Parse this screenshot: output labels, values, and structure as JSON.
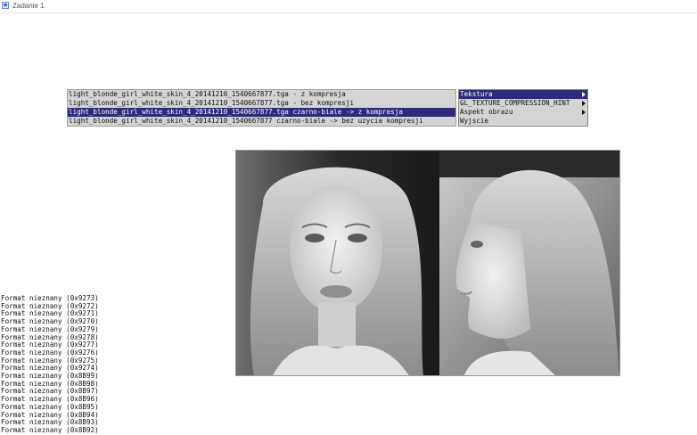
{
  "window": {
    "title": "Zadanie 1"
  },
  "submenu": {
    "items": [
      "light_blonde_girl_white_skin_4_20141210_1540667877.tga - z kompresja",
      "light_blonde_girl_white_skin_4_20141210_1540667877.tga  - bez kompresji",
      "light_blonde_girl_white_skin_4_20141210_1540667877.tga czarno-biale -> z kompresja",
      "light_blonde_girl_white_skin_4_20141210_1540667877 czarno-biale -> bez uzycia kompresji"
    ],
    "selected_index": 2
  },
  "menu": {
    "items": [
      {
        "label": "Tekstura",
        "has_submenu": true
      },
      {
        "label": "GL_TEXTURE_COMPRESSION_HINT",
        "has_submenu": true
      },
      {
        "label": "Aspekt obrazu",
        "has_submenu": true
      },
      {
        "label": "Wyjscie",
        "has_submenu": false
      }
    ],
    "selected_index": 0
  },
  "console": {
    "lines": [
      "Format nieznany (0x9273)",
      "Format nieznany (0x9272)",
      "Format nieznany (0x9271)",
      "Format nieznany (0x9270)",
      "Format nieznany (0x9279)",
      "Format nieznany (0x9278)",
      "Format nieznany (0x9277)",
      "Format nieznany (0x9276)",
      "Format nieznany (0x9275)",
      "Format nieznany (0x9274)",
      "Format nieznany (0x8B99)",
      "Format nieznany (0x8B98)",
      "Format nieznany (0x8B97)",
      "Format nieznany (0x8B96)",
      "Format nieznany (0x8B95)",
      "Format nieznany (0x8B94)",
      "Format nieznany (0x8B93)",
      "Format nieznany (0x8B92)"
    ]
  },
  "colors": {
    "menu_background": "#d4d4d4",
    "selection": "#2c2a79",
    "selection_text": "#ffffff"
  }
}
